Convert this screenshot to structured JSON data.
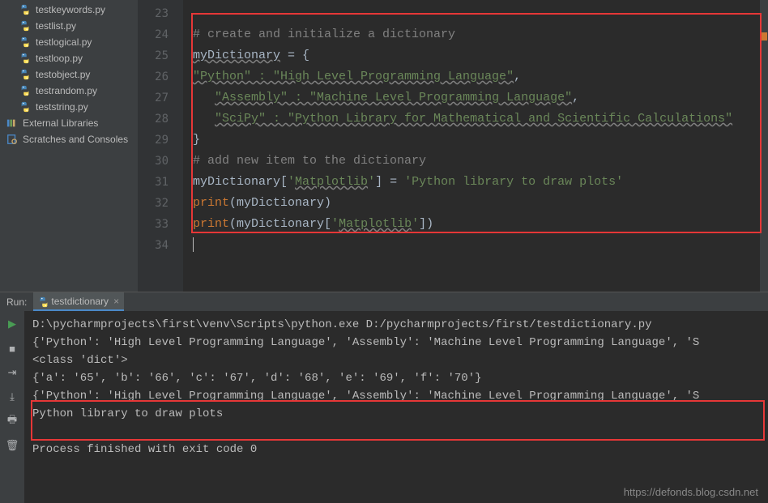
{
  "sidebar": {
    "files": [
      {
        "label": "testkeywords.py"
      },
      {
        "label": "testlist.py"
      },
      {
        "label": "testlogical.py"
      },
      {
        "label": "testloop.py"
      },
      {
        "label": "testobject.py"
      },
      {
        "label": "testrandom.py"
      },
      {
        "label": "teststring.py"
      }
    ],
    "externalLibs": "External Libraries",
    "scratches": "Scratches and Consoles"
  },
  "editor": {
    "lineStart": 23,
    "code": [
      {
        "segments": []
      },
      {
        "segments": [
          {
            "t": "# create and initialize a dictionary",
            "c": "c-comment"
          }
        ]
      },
      {
        "segments": [
          {
            "t": "myDictionary",
            "c": "c-warn-key"
          },
          {
            "t": " = {",
            "c": "c-default"
          }
        ]
      },
      {
        "segments": [
          {
            "t": "\"Python\" : \"High Level Programming Language\"",
            "c": "c-warn"
          },
          {
            "t": ",",
            "c": "c-default"
          }
        ]
      },
      {
        "segments": [
          {
            "t": "   ",
            "c": "c-default"
          },
          {
            "t": "\"Assembly\" : \"Machine Level Programming Language\"",
            "c": "c-warn"
          },
          {
            "t": ",",
            "c": "c-default"
          }
        ]
      },
      {
        "segments": [
          {
            "t": "   ",
            "c": "c-default"
          },
          {
            "t": "\"SciPy\" : \"Python Library for Mathematical and Scientific Calculations\"",
            "c": "c-warn"
          }
        ]
      },
      {
        "segments": [
          {
            "t": "}",
            "c": "c-default"
          }
        ]
      },
      {
        "segments": [
          {
            "t": "# add new item to the dictionary",
            "c": "c-comment"
          }
        ]
      },
      {
        "segments": [
          {
            "t": "myDictionary[",
            "c": "c-default"
          },
          {
            "t": "'",
            "c": "c-string"
          },
          {
            "t": "Matplotlib",
            "c": "c-warn"
          },
          {
            "t": "'",
            "c": "c-string"
          },
          {
            "t": "] = ",
            "c": "c-default"
          },
          {
            "t": "'Python library to draw plots'",
            "c": "c-string"
          }
        ]
      },
      {
        "segments": [
          {
            "t": "print",
            "c": "c-keyword"
          },
          {
            "t": "(myDictionary)",
            "c": "c-default"
          }
        ]
      },
      {
        "segments": [
          {
            "t": "print",
            "c": "c-keyword"
          },
          {
            "t": "(myDictionary[",
            "c": "c-default"
          },
          {
            "t": "'",
            "c": "c-string"
          },
          {
            "t": "Matplotlib",
            "c": "c-warn"
          },
          {
            "t": "'",
            "c": "c-string"
          },
          {
            "t": "])",
            "c": "c-default"
          }
        ]
      },
      {
        "segments": [],
        "cursor": true
      }
    ]
  },
  "run": {
    "label": "Run:",
    "tab": "testdictionary",
    "output": [
      "D:\\pycharmprojects\\first\\venv\\Scripts\\python.exe D:/pycharmprojects/first/testdictionary.py",
      "{'Python': 'High Level Programming Language', 'Assembly': 'Machine Level Programming Language', 'S",
      "<class 'dict'>",
      "{'a': '65', 'b': '66', 'c': '67', 'd': '68', 'e': '69', 'f': '70'}",
      "{'Python': 'High Level Programming Language', 'Assembly': 'Machine Level Programming Language', 'S",
      "Python library to draw plots",
      "",
      "Process finished with exit code 0"
    ]
  },
  "watermark": "https://defonds.blog.csdn.net"
}
